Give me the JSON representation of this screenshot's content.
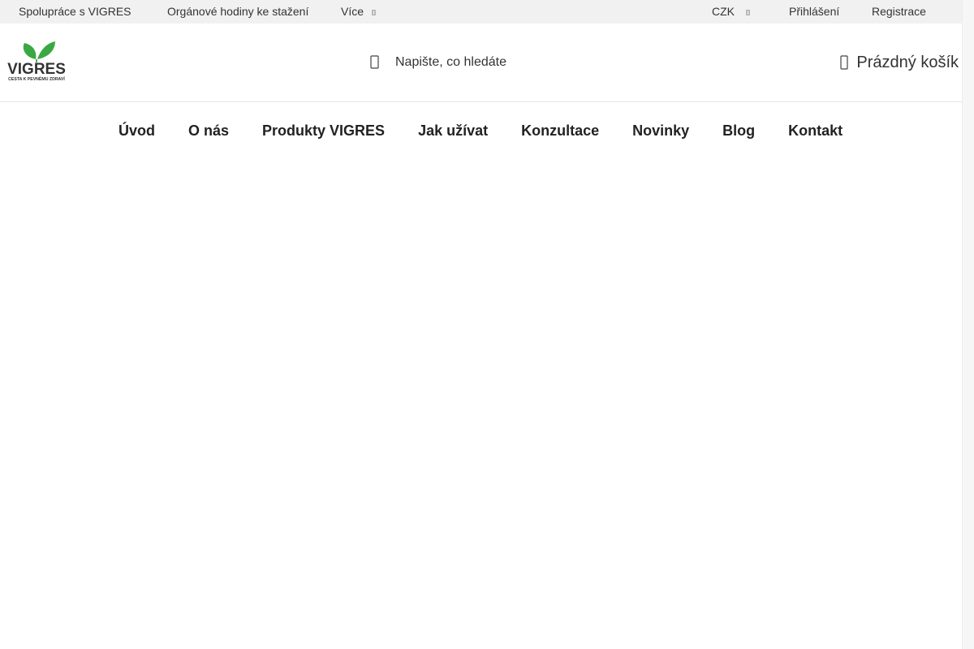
{
  "topbar": {
    "links": [
      {
        "label": "Spolupráce s VIGRES"
      },
      {
        "label": "Orgánové hodiny ke stažení"
      },
      {
        "label": "Více"
      }
    ],
    "currency": "CZK",
    "login": "Přihlášení",
    "register": "Registrace"
  },
  "header": {
    "logo": {
      "brand": "VIGRES",
      "tagline": "CESTA K PEVNÉMU ZDRAVÍ",
      "leaf_color": "#3aa845",
      "text_color": "#333333"
    },
    "search": {
      "placeholder": "Napište, co hledáte",
      "icon": "search-icon"
    },
    "cart": {
      "label": "Prázdný košík",
      "icon": "cart-icon"
    }
  },
  "nav": {
    "items": [
      {
        "label": "Úvod"
      },
      {
        "label": "O nás"
      },
      {
        "label": "Produkty VIGRES"
      },
      {
        "label": "Jak užívat"
      },
      {
        "label": "Konzultace"
      },
      {
        "label": "Novinky"
      },
      {
        "label": "Blog"
      },
      {
        "label": "Kontakt"
      }
    ]
  }
}
